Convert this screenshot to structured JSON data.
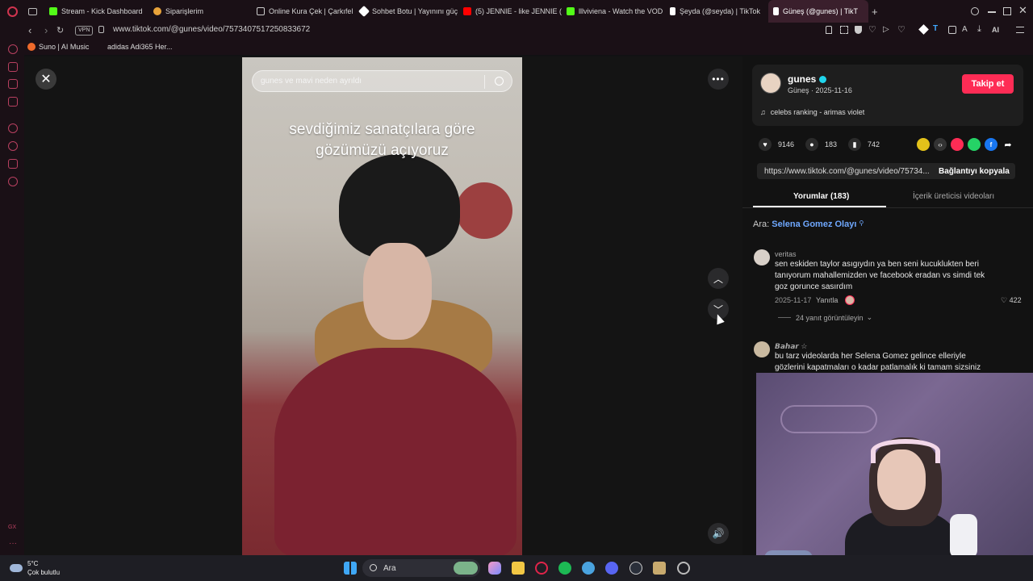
{
  "browser": {
    "tabs": [
      {
        "label": "Stream - Kick Dashboard",
        "favicon_color": "#53fc18"
      },
      {
        "label": "Siparişlerim",
        "favicon_color": "#e8a33a"
      },
      {
        "label": "Online Kura Çek | Çarkıfel",
        "favicon_color": "#cccccc"
      },
      {
        "label": "Sohbet Botu | Yayınını güç",
        "favicon_color": "#ffffff"
      },
      {
        "label": "(5) JENNIE - like JENNIE (",
        "favicon_color": "#ff0000"
      },
      {
        "label": "lllviviena - Watch the VOD",
        "favicon_color": "#53fc18"
      },
      {
        "label": "Şeyda (@seyda) | TikTok",
        "favicon_color": "#ffffff"
      },
      {
        "label": "Güneş (@gunes) | TikT",
        "favicon_color": "#ffffff"
      }
    ],
    "vpn_label": "VPN",
    "url": "www.tiktok.com/@gunes/video/7573407517250833672",
    "ai_label": "AI",
    "bookmarks": [
      "Suno | AI Music",
      "adidas Adi365 Her..."
    ]
  },
  "video": {
    "search_text": "gunes ve mavi neden ayrıldı",
    "overlay_line1": "sevdiğimiz sanatçılara göre",
    "overlay_line2": "gözümüzü açıyoruz"
  },
  "profile": {
    "username": "gunes",
    "meta": "Güneş · 2025-11-16",
    "follow_label": "Takip et",
    "music": "celebs ranking - arimas violet"
  },
  "stats": {
    "likes": "9146",
    "comments": "183",
    "saves": "742"
  },
  "share_link": {
    "url": "https://www.tiktok.com/@gunes/video/75734...",
    "copy_label": "Bağlantıyı kopyala"
  },
  "tabs": {
    "comments": "Yorumlar (183)",
    "creator_videos": "İçerik üreticisi videoları"
  },
  "search_suggest": {
    "prefix": "Ara:",
    "query": "Selena Gomez Olayı"
  },
  "comments": [
    {
      "author": "veritas",
      "line1": "sen eskiden taylor asıgıydın ya ben seni kucuklukten beri",
      "line2": "tanıyorum mahallemizden ve facebook eradan vs simdi tek",
      "line3": "goz gorunce sasırdım",
      "date": "2025-11-17",
      "reply_label": "Yanıtla",
      "likes": "422",
      "view_replies": "24 yanıt görüntüleyin"
    },
    {
      "author": "𝘽𝙖𝙝𝙖𝙧 ☆",
      "line1": "bu tarz videolarda her Selena Gomez gelince elleriyle",
      "line2": "gözlerini kapatmaları o kadar patlamalık ki tamam sizsiniz"
    }
  ],
  "taskbar": {
    "weather_temp": "5°C",
    "weather_desc": "Çok bulutlu",
    "search_label": "Ara"
  },
  "sidebar_bottom": "GX"
}
